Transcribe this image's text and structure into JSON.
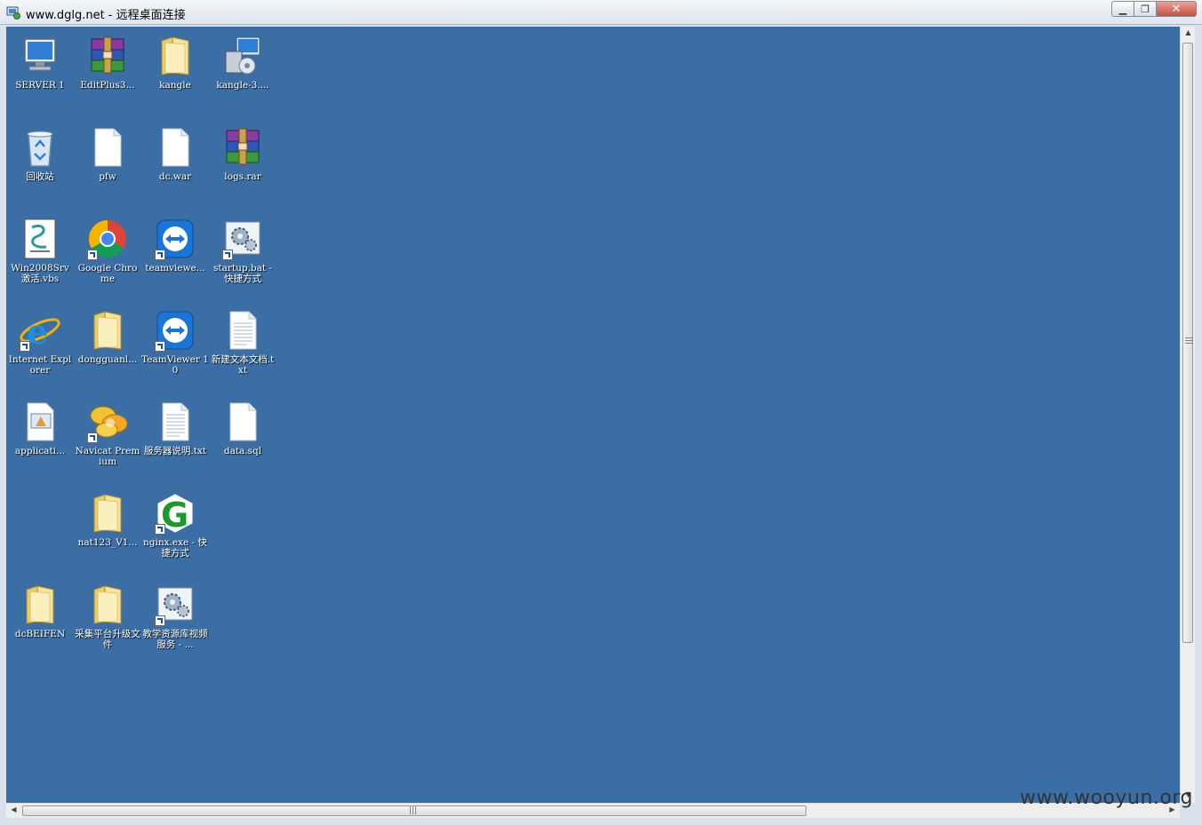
{
  "window": {
    "title": "www.dglg.net - 远程桌面连接",
    "minimize_glyph": "▁",
    "restore_glyph": "❐",
    "close_glyph": "✕"
  },
  "desktop": {
    "background_color": "#3a6ea5",
    "icons": [
      {
        "label": "SERVER 1",
        "icon": "computer-icon"
      },
      {
        "label": "EditPlus3...",
        "icon": "winrar-archive-icon"
      },
      {
        "label": "kangle",
        "icon": "folder-icon"
      },
      {
        "label": "kangle-3....",
        "icon": "installer-icon"
      },
      {
        "label": "回收站",
        "icon": "recycle-bin-icon"
      },
      {
        "label": "pfw",
        "icon": "blank-file-icon"
      },
      {
        "label": "dc.war",
        "icon": "blank-file-icon"
      },
      {
        "label": "logs.rar",
        "icon": "winrar-archive-icon"
      },
      {
        "label": "Win2008Srv激活.vbs",
        "icon": "vbs-script-icon"
      },
      {
        "label": "Google Chrome",
        "icon": "chrome-icon"
      },
      {
        "label": "teamviewe...",
        "icon": "teamviewer-icon"
      },
      {
        "label": "startup.bat - 快捷方式",
        "icon": "batch-gear-icon"
      },
      {
        "label": "Internet Explorer",
        "icon": "internet-explorer-icon"
      },
      {
        "label": "dongguanl...",
        "icon": "folder-icon"
      },
      {
        "label": "TeamViewer 10",
        "icon": "teamviewer-icon"
      },
      {
        "label": "新建文本文档.txt",
        "icon": "text-file-icon"
      },
      {
        "label": "applicati...",
        "icon": "application-file-icon"
      },
      {
        "label": "Navicat Premium",
        "icon": "navicat-icon"
      },
      {
        "label": "服务器说明.txt",
        "icon": "text-file-icon"
      },
      {
        "label": "data.sql",
        "icon": "blank-file-icon"
      },
      {
        "label": "nat123_V1...",
        "icon": "folder-icon"
      },
      {
        "label": "nginx.exe - 快捷方式",
        "icon": "nginx-icon"
      },
      {
        "label": "dcBEIFEN",
        "icon": "folder-icon"
      },
      {
        "label": "采集平台升级文件",
        "icon": "folder-icon"
      },
      {
        "label": "教学资源库视频服务 - ...",
        "icon": "batch-gear-icon"
      }
    ]
  },
  "scrollbars": {
    "up_arrow": "▲",
    "down_arrow": "▼",
    "left_arrow": "◀",
    "right_arrow": "▶",
    "grip": "|||"
  },
  "watermark": "www.wooyun.org"
}
